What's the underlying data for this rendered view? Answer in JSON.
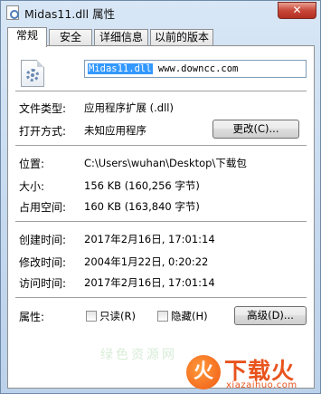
{
  "window": {
    "title": "Midas11.dll 属性",
    "close_symbol": "✕"
  },
  "tabs": [
    {
      "label": "常规",
      "active": true
    },
    {
      "label": "安全",
      "active": false
    },
    {
      "label": "详细信息",
      "active": false
    },
    {
      "label": "以前的版本",
      "active": false
    }
  ],
  "general": {
    "file_icon": "dll-gear-icon",
    "filename": "Midas11.dll",
    "filename_suffix": " www.downcc.com",
    "rows": {
      "file_type_label": "文件类型:",
      "file_type_value": "应用程序扩展 (.dll)",
      "opens_with_label": "打开方式:",
      "opens_with_value": "未知应用程序",
      "change_button": "更改(C)...",
      "location_label": "位置:",
      "location_value": "C:\\Users\\wuhan\\Desktop\\下载包",
      "size_label": "大小:",
      "size_value": "156 KB (160,256 字节)",
      "size_on_disk_label": "占用空间:",
      "size_on_disk_value": "160 KB (163,840 字节)",
      "created_label": "创建时间:",
      "created_value": "2017年2月16日, 17:01:14",
      "modified_label": "修改时间:",
      "modified_value": "2004年1月22日, 0:20:22",
      "accessed_label": "访问时间:",
      "accessed_value": "2017年2月16日, 17:01:14",
      "attributes_label": "属性:",
      "readonly_label": "只读(R)",
      "readonly_checked": false,
      "hidden_label": "隐藏(H)",
      "hidden_checked": false,
      "advanced_button": "高级(D)..."
    }
  },
  "watermark": {
    "logo_glyph": "火",
    "brand": "下载火",
    "site": "xiazaihuo.com",
    "faint_text": "绿色资源网"
  },
  "colors": {
    "selection": "#3399ff",
    "close_button": "#c8483a",
    "watermark": "#e8531d"
  }
}
